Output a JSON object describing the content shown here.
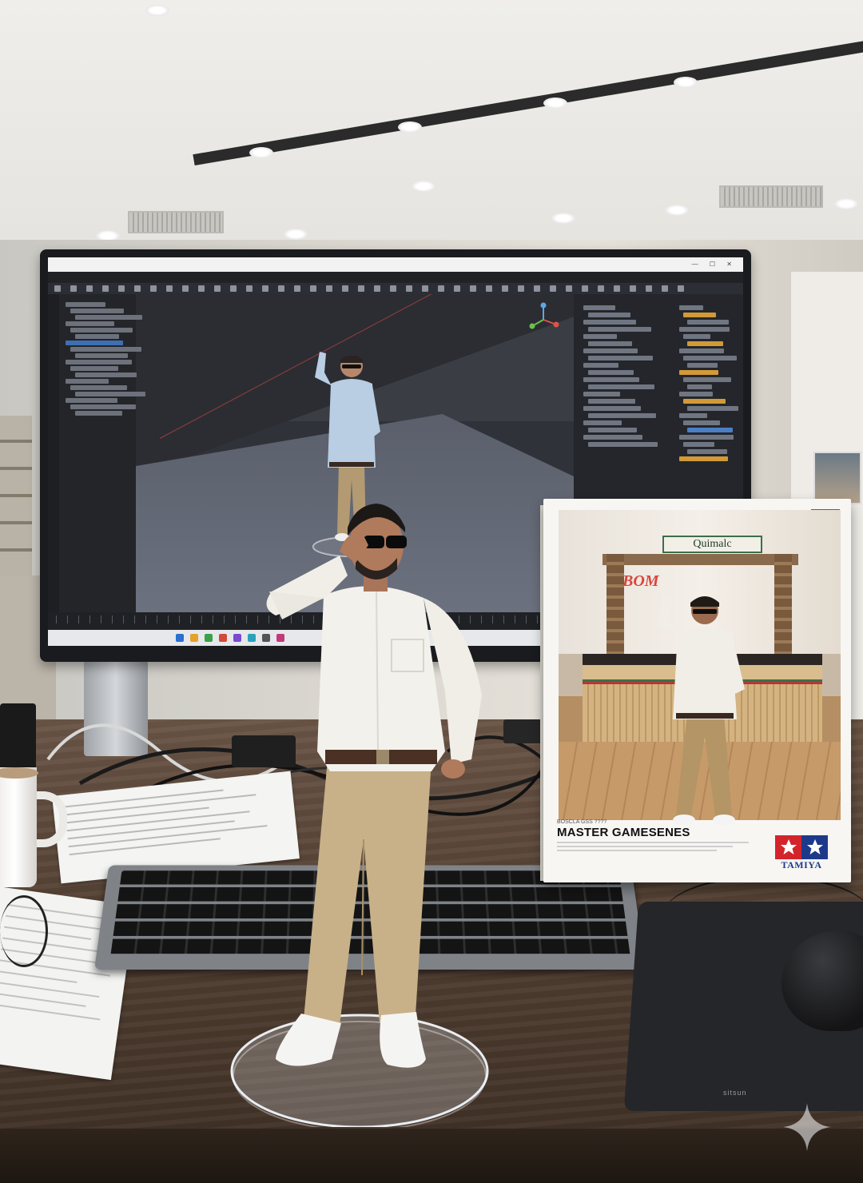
{
  "monitor": {
    "window_title": "",
    "menu_items": [
      "",
      "",
      "",
      "",
      "",
      "",
      "",
      "",
      "",
      "",
      "",
      "",
      "",
      "",
      ""
    ]
  },
  "box": {
    "sign_text": "Quimalc",
    "watermark": "BOM",
    "subtitle": "BOSCLA GSS ???? ",
    "title": "MASTER GAMESENES",
    "brand": "TAMIYA"
  },
  "mousepad": {
    "logo": "sitsun"
  },
  "colors": {
    "desk": "#5a4638",
    "shirt": "#f3f1ec",
    "pants": "#c8b188",
    "tamiya_red": "#d3242c",
    "tamiya_blue": "#1d3a8a"
  }
}
